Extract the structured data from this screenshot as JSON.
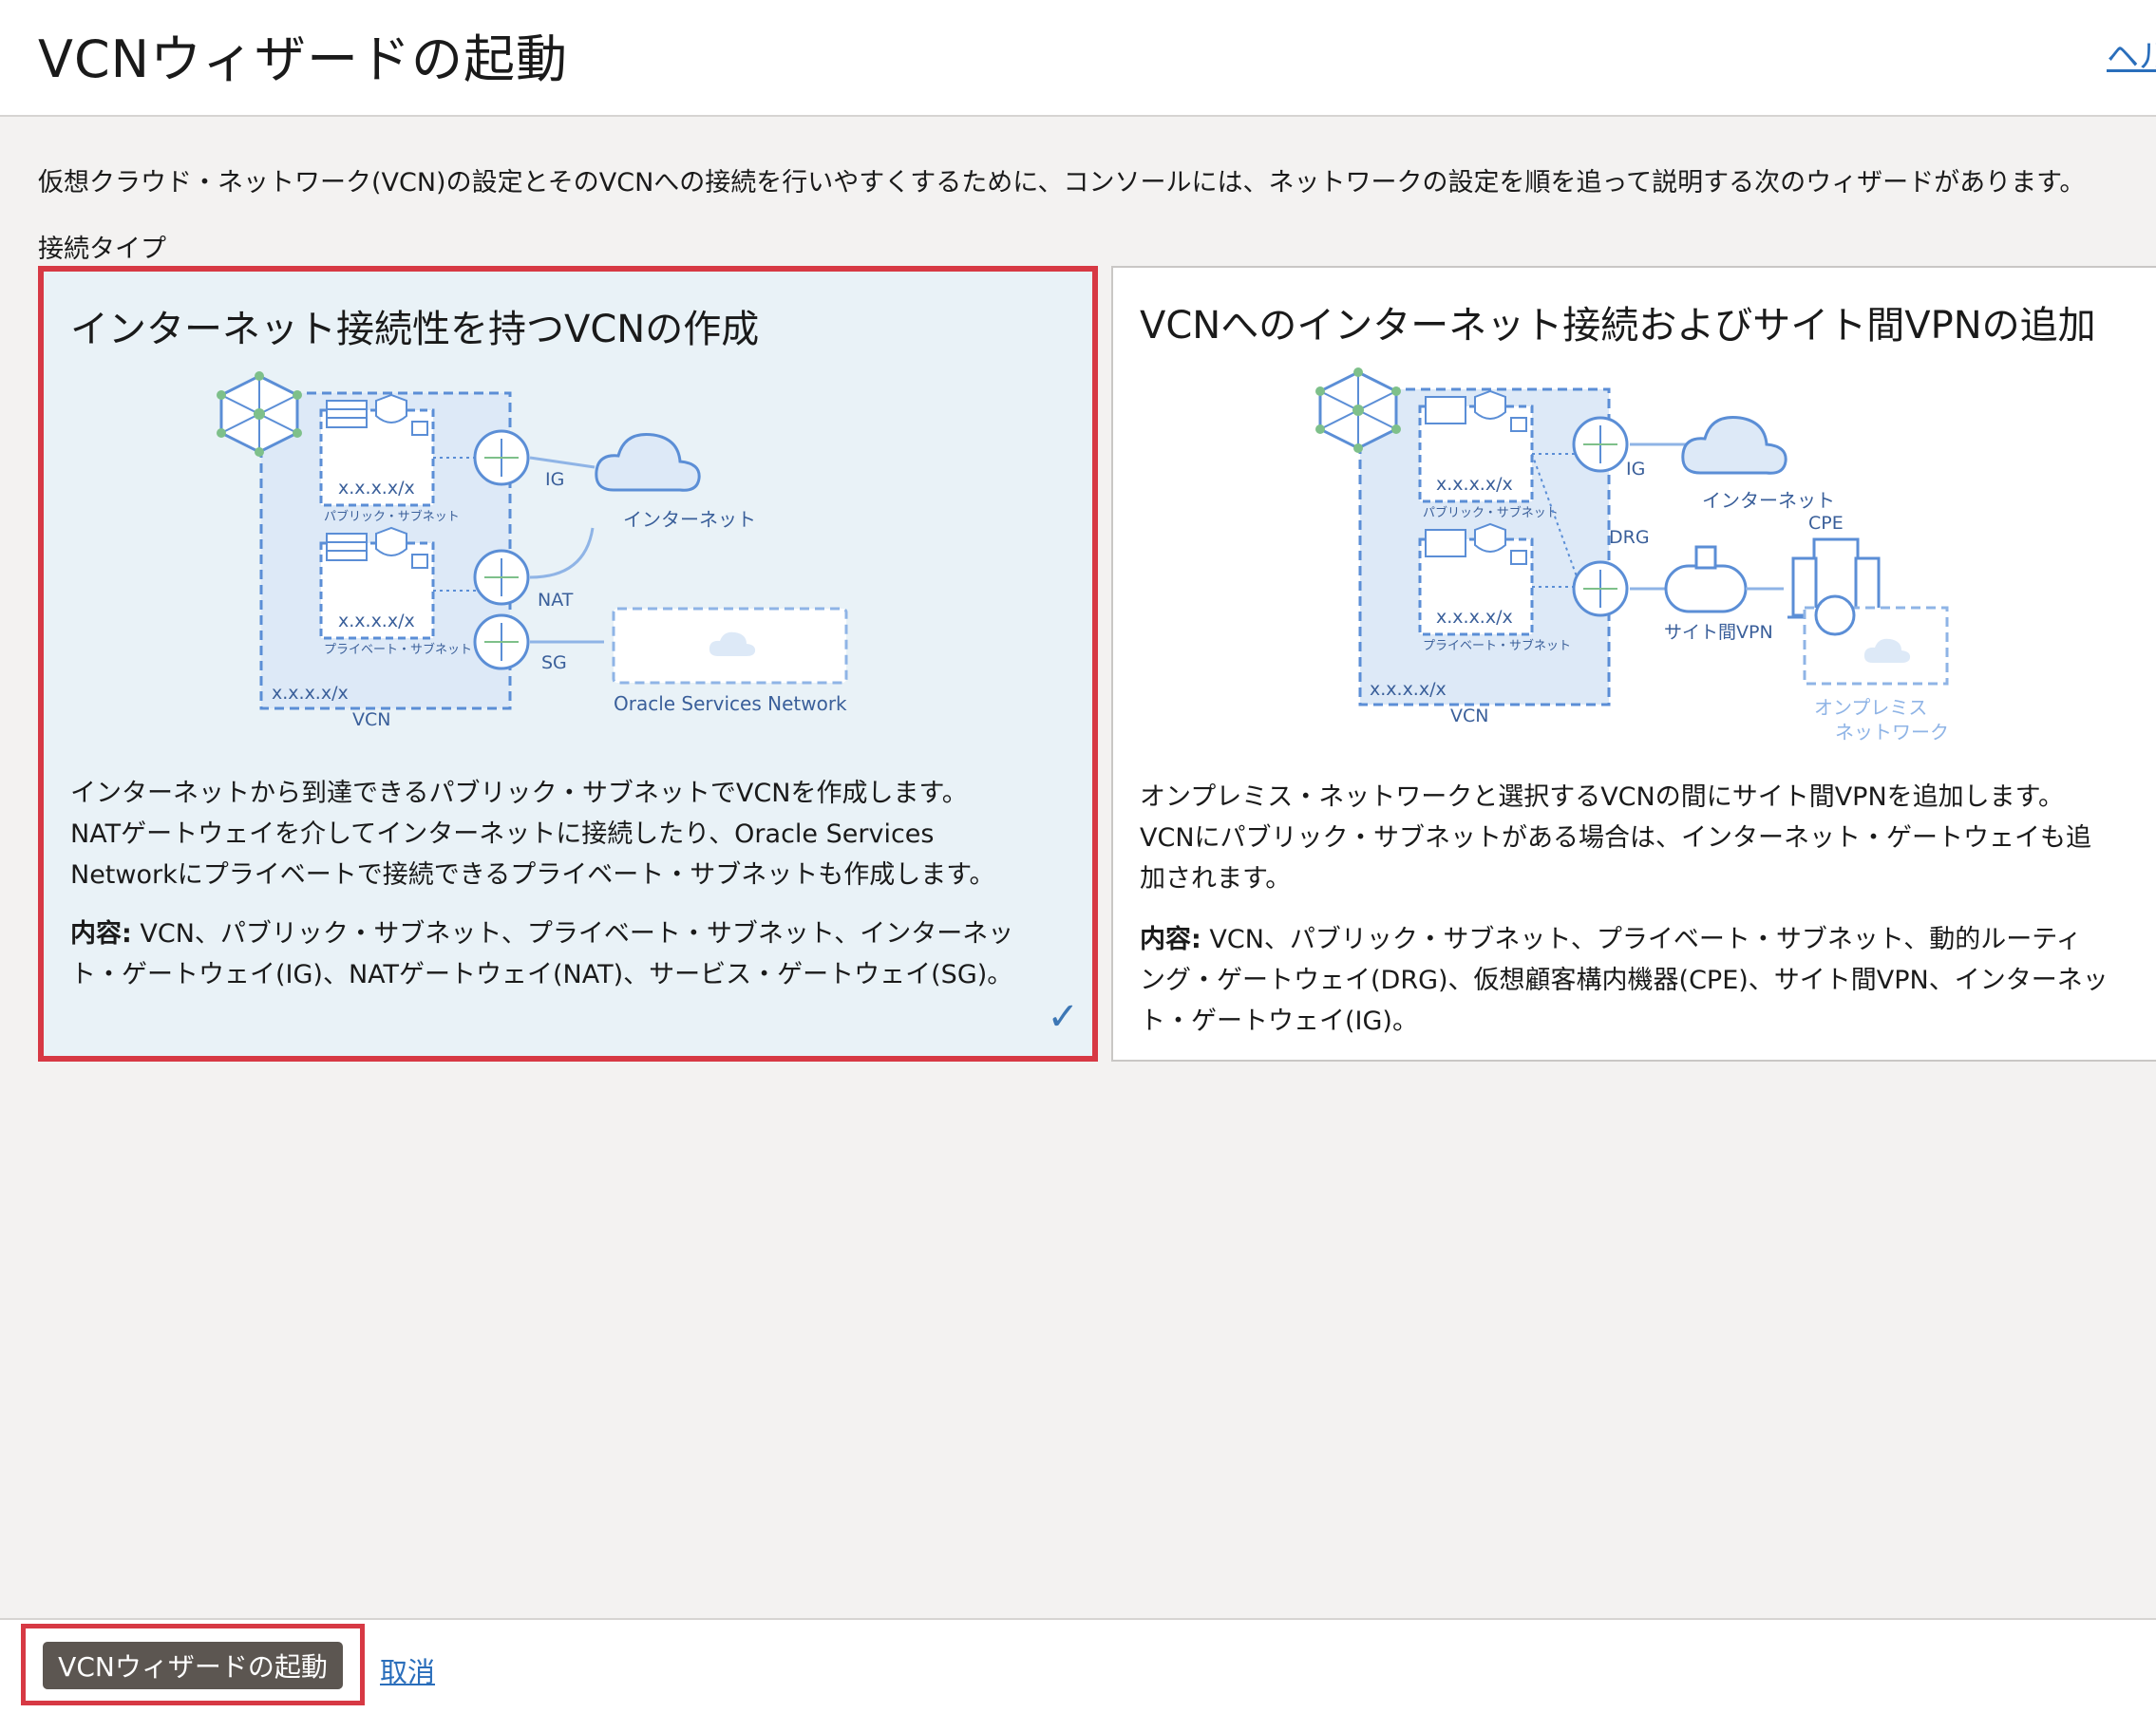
{
  "header": {
    "title": "VCNウィザードの起動",
    "help_label": "ヘル"
  },
  "intro_text": "仮想クラウド・ネットワーク(VCN)の設定とそのVCNへの接続を行いやすくするために、コンソールには、ネットワークの設定を順を追って説明する次のウィザードがあります。",
  "section_label": "接続タイプ",
  "cards": [
    {
      "title": "インターネット接続性を持つVCNの作成",
      "selected": true,
      "diagram": {
        "subnet_public_cidr": "x.x.x.x/x",
        "subnet_public_label": "パブリック・サブネット",
        "subnet_private_cidr": "x.x.x.x/x",
        "subnet_private_label": "プライベート・サブネット",
        "vcn_cidr": "x.x.x.x/x",
        "vcn_label": "VCN",
        "ig_label": "IG",
        "nat_label": "NAT",
        "sg_label": "SG",
        "internet_label": "インターネット",
        "osn_label": "Oracle Services Network"
      },
      "description_lines": [
        "インターネットから到達できるパブリック・サブネットでVCNを作成します。",
        "NATゲートウェイを介してインターネットに接続したり、Oracle Services",
        "Networkにプライベートで接続できるプライベート・サブネットも作成します。"
      ],
      "contents_label": "内容:",
      "contents_lines": [
        "VCN、パブリック・サブネット、プライベート・サブネット、インターネッ",
        "ト・ゲートウェイ(IG)、NATゲートウェイ(NAT)、サービス・ゲートウェイ(SG)。"
      ],
      "check": "✓"
    },
    {
      "title": "VCNへのインターネット接続およびサイト間VPNの追加",
      "selected": false,
      "diagram": {
        "subnet_public_cidr": "x.x.x.x/x",
        "subnet_public_label": "パブリック・サブネット",
        "subnet_private_cidr": "x.x.x.x/x",
        "subnet_private_label": "プライベート・サブネット",
        "vcn_cidr": "x.x.x.x/x",
        "vcn_label": "VCN",
        "ig_label": "IG",
        "drg_label": "DRG",
        "internet_label": "インターネット",
        "cpe_label": "CPE",
        "vpn_label": "サイト間VPN",
        "onprem_label_1": "オンプレミス",
        "onprem_label_2": "ネットワーク"
      },
      "description_lines": [
        "オンプレミス・ネットワークと選択するVCNの間にサイト間VPNを追加します。",
        "VCNにパブリック・サブネットがある場合は、インターネット・ゲートウェイも追",
        "加されます。"
      ],
      "contents_label": "内容:",
      "contents_lines": [
        "VCN、パブリック・サブネット、プライベート・サブネット、動的ルーティ",
        "ング・ゲートウェイ(DRG)、仮想顧客構内機器(CPE)、サイト間VPN、インターネッ",
        "ト・ゲートウェイ(IG)。"
      ]
    }
  ],
  "footer": {
    "primary_label": "VCNウィザードの起動",
    "cancel_label": "取消"
  },
  "colors": {
    "accent_blue": "#2a6ebb",
    "diagram_blue": "#5b8ed6",
    "selection_red": "#d73944",
    "primary_button": "#5c5651"
  }
}
